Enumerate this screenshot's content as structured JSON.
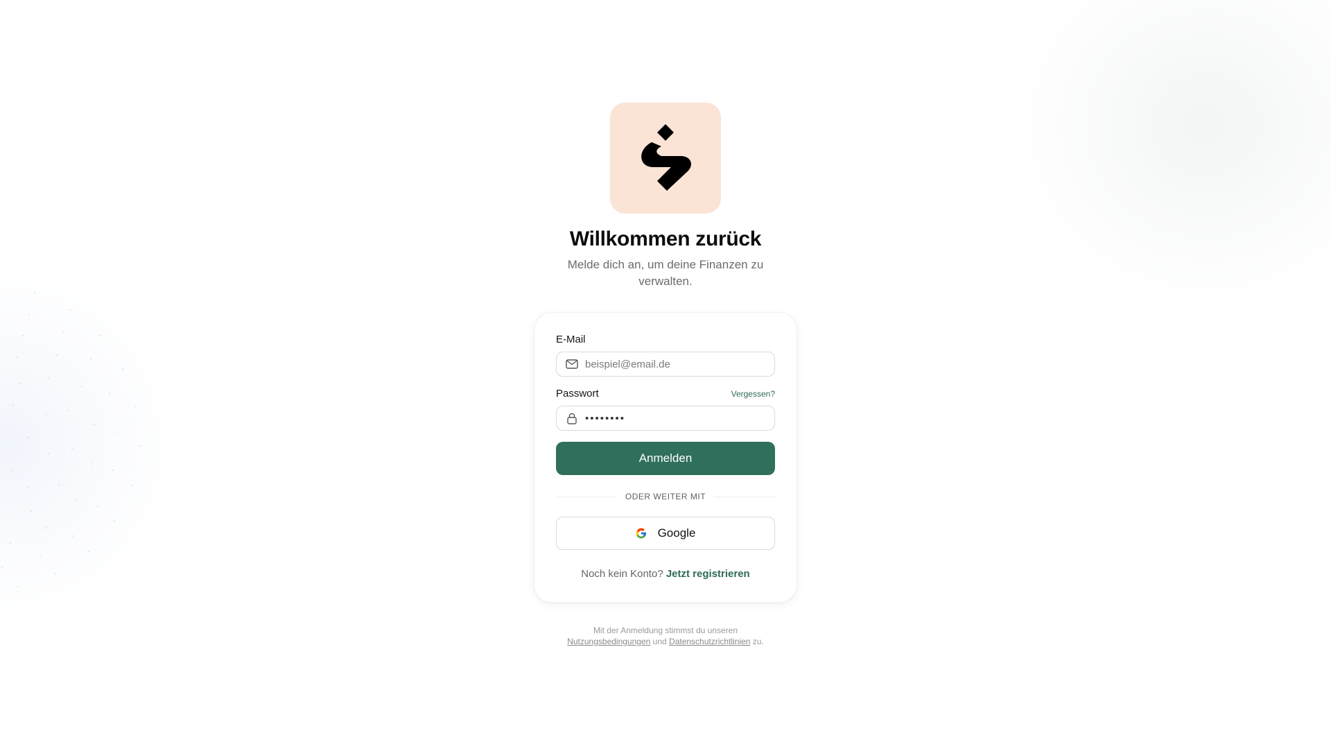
{
  "brand": {
    "logo_icon": "brand-logo-icon",
    "tile_color": "#fbe3d6"
  },
  "header": {
    "title": "Willkommen zurück",
    "subtitle": "Melde dich an, um deine Finanzen zu verwalten."
  },
  "form": {
    "email": {
      "label": "E-Mail",
      "placeholder": "beispiel@email.de",
      "value": "",
      "icon": "mail-icon"
    },
    "password": {
      "label": "Passwort",
      "forgot_label": "Vergessen?",
      "value": "••••••••",
      "icon": "lock-icon"
    },
    "submit_label": "Anmelden",
    "divider_text": "ODER WEITER MIT",
    "google_label": "Google",
    "register_prompt": "Noch kein Konto?",
    "register_link": "Jetzt registrieren"
  },
  "legal": {
    "prefix": "Mit der Anmeldung stimmst du unseren",
    "terms_link": "Nutzungsbedingungen",
    "middle": "und",
    "privacy_link": "Datenschutzrichtlinien",
    "suffix": "zu."
  },
  "colors": {
    "accent": "#2f6f5c",
    "link": "#2e6b55"
  }
}
